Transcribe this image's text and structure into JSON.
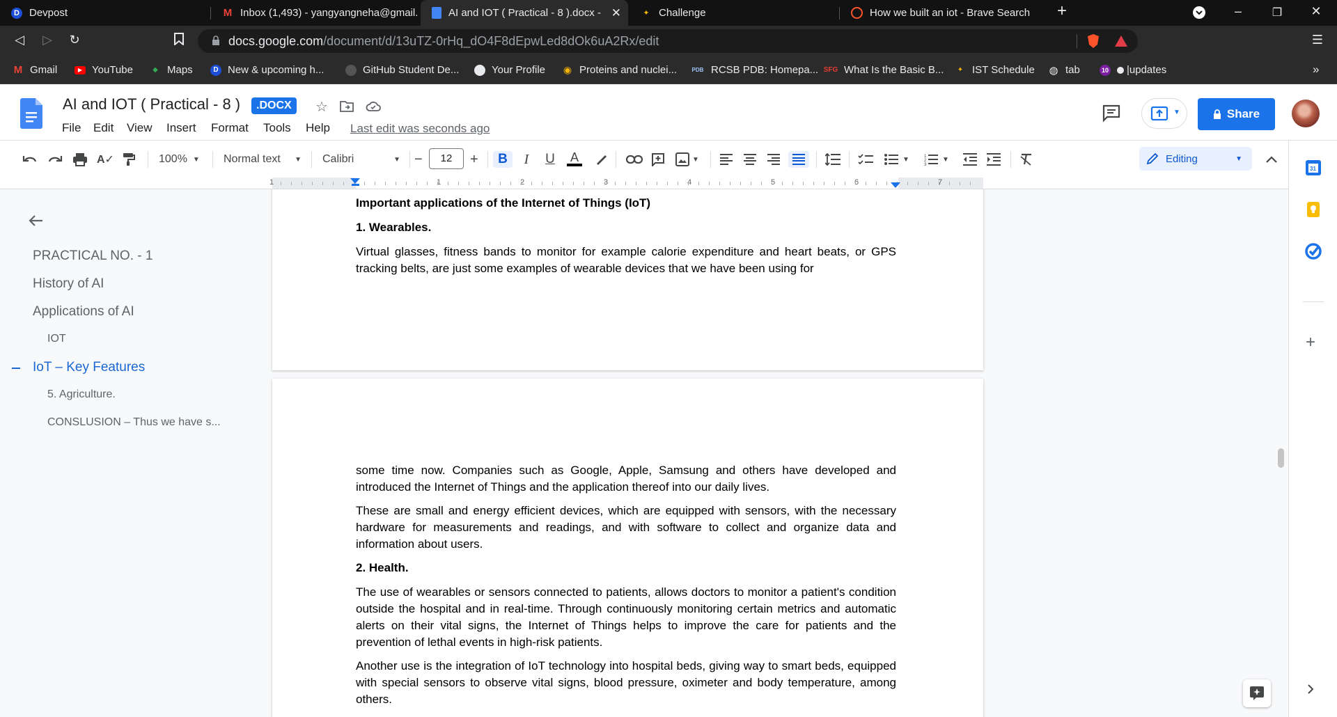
{
  "browser": {
    "tabs": [
      {
        "title": "Devpost",
        "favicon": "D",
        "color": "#1d4ed8"
      },
      {
        "title": "Inbox (1,493) - yangyangneha@gmail.",
        "favicon": "M",
        "color": "#ea4335"
      },
      {
        "title": "AI and IOT ( Practical - 8 ).docx - ",
        "favicon": "docs",
        "color": "#4285f4",
        "active": true
      },
      {
        "title": "Challenge",
        "favicon": "flame",
        "color": "#f4b400"
      },
      {
        "title": "How we built an iot - Brave Search",
        "favicon": "brave",
        "color": "#fb542b"
      }
    ],
    "new_tab_label": "+",
    "url_host": "docs.google.com",
    "url_path": "/document/d/13uTZ-0rHq_dO4F8dEpwLed8dOk6uA2Rx/edit",
    "bookmarks": [
      {
        "label": "Gmail",
        "icon": "M",
        "color": "#ea4335"
      },
      {
        "label": "YouTube",
        "icon": "▶",
        "color": "#ff0000"
      },
      {
        "label": "Maps",
        "icon": "◆",
        "color": "#34a853"
      },
      {
        "label": "New & upcoming h...",
        "icon": "D",
        "color": "#1d4ed8"
      },
      {
        "label": "GitHub Student De...",
        "icon": "●",
        "color": "#333"
      },
      {
        "label": "Your Profile",
        "icon": "●",
        "color": "#333"
      },
      {
        "label": "Proteins and nuclei...",
        "icon": "◉",
        "color": "#f4b400"
      },
      {
        "label": "RCSB PDB: Homepa...",
        "icon": "PDB",
        "color": "#2b2b2b"
      },
      {
        "label": "What Is the Basic B...",
        "icon": "SFG",
        "color": "#2b2b2b"
      },
      {
        "label": "IST Schedule",
        "icon": "✦",
        "color": "#2b2b2b"
      },
      {
        "label": "tab",
        "icon": "◍",
        "color": "#2b2b2b"
      },
      {
        "label": "|updates",
        "icon": "10",
        "color": "#7b1fa2"
      }
    ],
    "more_bookmarks": "»"
  },
  "docs": {
    "title": "AI and IOT ( Practical - 8 )",
    "badge": ".DOCX",
    "menus": [
      "File",
      "Edit",
      "View",
      "Insert",
      "Format",
      "Tools",
      "Help"
    ],
    "last_edit": "Last edit was seconds ago",
    "share_label": "Share",
    "toolbar": {
      "zoom": "100%",
      "style": "Normal text",
      "font": "Calibri",
      "font_size": "12",
      "minus": "−",
      "plus": "+",
      "mode": "Editing"
    },
    "ruler_numbers": [
      "1",
      "1",
      "2",
      "3",
      "4",
      "5",
      "6",
      "7"
    ]
  },
  "outline": {
    "items": [
      {
        "label": "PRACTICAL NO. - 1",
        "level": 1
      },
      {
        "label": "History of AI",
        "level": 1
      },
      {
        "label": "Applications of AI",
        "level": 1
      },
      {
        "label": "IOT",
        "level": 2
      },
      {
        "label": "IoT – Key Features",
        "level": 1,
        "current": true
      },
      {
        "label": "5. Agriculture.",
        "level": 2
      },
      {
        "label": "CONSLUSION – Thus we have s...",
        "level": 2
      }
    ]
  },
  "document": {
    "page1": {
      "heading": "Important applications of the Internet of Things (IoT)",
      "sub1": "1. Wearables.",
      "para1": "Virtual glasses, fitness bands to monitor for example calorie expenditure and heart beats, or GPS tracking belts, are just some examples of wearable devices that we have been using for"
    },
    "page2": {
      "para1": "some time now. Companies such as Google, Apple, Samsung and others have developed and introduced the Internet of Things and the application thereof into our daily lives.",
      "para2": "These are small and energy efficient devices, which are equipped with sensors, with the necessary hardware for measurements and readings, and with software to collect and organize data and information about users.",
      "sub2": "2. Health.",
      "para3": "The use of wearables or sensors connected to patients, allows doctors to monitor a patient's condition outside the hospital and in real-time. Through continuously monitoring certain metrics and automatic alerts on their vital signs, the Internet of Things helps to improve the care for patients and the prevention of lethal events in high-risk patients.",
      "para4": "Another use is the integration of IoT technology into hospital beds, giving way to smart beds, equipped with special sensors to observe vital signs, blood pressure, oximeter and body temperature, among others."
    }
  },
  "colors": {
    "accent": "#1a73e8",
    "current_outline": "#1967d2",
    "chrome_dark": "#2b2b2b"
  }
}
